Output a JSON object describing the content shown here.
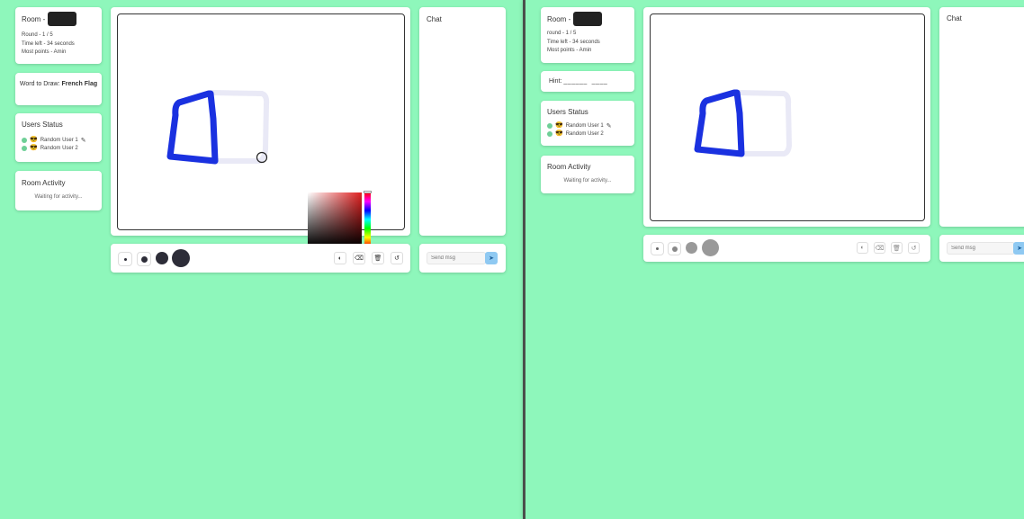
{
  "left": {
    "room": {
      "label": "Room -",
      "code": "XXXX",
      "round": "Round - 1 / 5",
      "time_left": "Time left - 34 seconds",
      "most_points": "Most points - Amin"
    },
    "word": {
      "prefix": "Word to Draw:",
      "value": "French Flag"
    },
    "users": {
      "title": "Users Status",
      "items": [
        {
          "name": "Random User 1",
          "drawing": true
        },
        {
          "name": "Random User 2",
          "drawing": false
        }
      ]
    },
    "activity": {
      "title": "Room Activity",
      "empty": "Waiting for activity..."
    },
    "chat": {
      "title": "Chat",
      "placeholder": "Send msg"
    }
  },
  "right": {
    "room": {
      "label": "Room -",
      "code": "XXXX",
      "round": "round - 1 / 5",
      "time_left": "Time left - 34 seconds",
      "most_points": "Most points - Amin"
    },
    "hint": {
      "label": "Hint:",
      "value": "______  ____"
    },
    "users": {
      "title": "Users Status",
      "items": [
        {
          "name": "Random User 1",
          "drawing": true
        },
        {
          "name": "Random User 2",
          "drawing": false
        }
      ]
    },
    "activity": {
      "title": "Room Activity",
      "empty": "Waiting for activity..."
    },
    "chat": {
      "title": "Chat",
      "placeholder": "Send msg"
    }
  },
  "icons": {
    "pencil": "pencil-icon",
    "palette": "palette-icon",
    "eraser": "eraser-icon",
    "trash": "trash-icon",
    "undo": "undo-icon",
    "send": "send-icon",
    "avatar": "avatar-icon"
  },
  "colors": {
    "background": "#8ef7bb",
    "stroke_blue": "#1a31e0",
    "stroke_erased": "#e9e9f6",
    "send_button": "#8fc9f2"
  }
}
